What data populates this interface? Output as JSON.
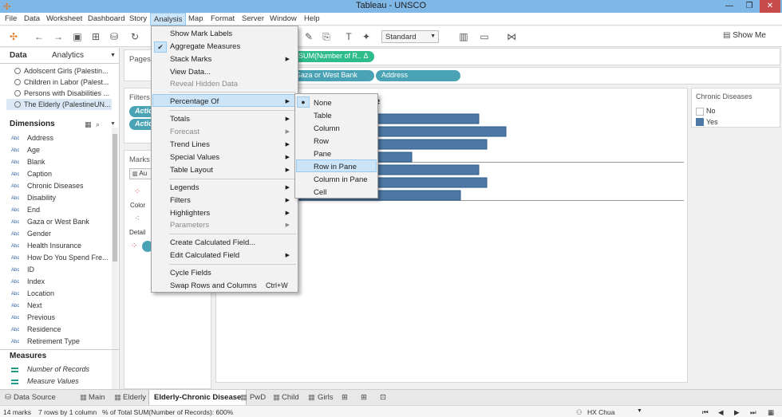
{
  "window": {
    "title": "Tableau - UNSCO"
  },
  "menubar": [
    "File",
    "Data",
    "Worksheet",
    "Dashboard",
    "Story",
    "Analysis",
    "Map",
    "Format",
    "Server",
    "Window",
    "Help"
  ],
  "toolbar": {
    "fit_value": "Standard",
    "show_me": "Show Me"
  },
  "left_pane": {
    "tabs": [
      "Data",
      "Analytics"
    ],
    "datasources": [
      "Adolscent Girls (Palestin...",
      "Children in Labor (Palest...",
      "Persons with Disabilities ...",
      "The Elderly (PalestineUN..."
    ],
    "dimensions_title": "Dimensions",
    "dimensions": [
      "Address",
      "Age",
      "Blank",
      "Caption",
      "Chronic Diseases",
      "Disability",
      "End",
      "Gaza or West Bank",
      "Gender",
      "Health Insurance",
      "How Do You Spend Fre...",
      "ID",
      "Index",
      "Location",
      "Next",
      "Previous",
      "Residence",
      "Retirement Type"
    ],
    "field_type_label": "Abc",
    "measures_title": "Measures",
    "measures": [
      "Number of Records",
      "Measure Values"
    ]
  },
  "shelves": {
    "pages": "Pages",
    "filters": "Filters",
    "filter_pills": [
      "Action",
      "Action"
    ],
    "marks": "Marks",
    "marks_type_short": "Au",
    "color": "Color",
    "detail": "Detail",
    "columns_pill": "SUM(Number of R..  Δ",
    "rows_pills": [
      "Gaza or West Bank",
      "Address"
    ]
  },
  "view": {
    "title_partial": "e"
  },
  "chart_data": {
    "type": "bar",
    "orientation": "horizontal",
    "values": [
      0.67,
      0.77,
      0.7,
      0.42,
      0.67,
      0.7,
      0.6
    ],
    "note_units": "fraction of pane"
  },
  "legend": {
    "title": "Chronic Diseases",
    "items": [
      {
        "label": "No",
        "color": "#ffffff"
      },
      {
        "label": "Yes",
        "color": "#4e79a7"
      }
    ]
  },
  "analysis_menu": [
    {
      "label": "Show Mark Labels"
    },
    {
      "label": "Aggregate Measures",
      "checked": true
    },
    {
      "label": "Stack Marks",
      "submenu": true
    },
    {
      "label": "View Data..."
    },
    {
      "label": "Reveal Hidden Data",
      "disabled": true
    },
    {
      "label": "Percentage Of",
      "submenu": true,
      "active": true
    },
    {
      "label": "Totals",
      "submenu": true
    },
    {
      "label": "Forecast",
      "submenu": true,
      "disabled": true
    },
    {
      "label": "Trend Lines",
      "submenu": true
    },
    {
      "label": "Special Values",
      "submenu": true
    },
    {
      "label": "Table Layout",
      "submenu": true
    },
    {
      "label": "Legends",
      "submenu": true
    },
    {
      "label": "Filters",
      "submenu": true
    },
    {
      "label": "Highlighters",
      "submenu": true
    },
    {
      "label": "Parameters",
      "submenu": true,
      "disabled": true
    },
    {
      "label": "Create Calculated Field..."
    },
    {
      "label": "Edit Calculated Field",
      "submenu": true
    },
    {
      "label": "Cycle Fields"
    },
    {
      "label": "Swap Rows and Columns",
      "shortcut": "Ctrl+W"
    }
  ],
  "percentage_submenu": [
    {
      "label": "None",
      "selected": true
    },
    {
      "label": "Table"
    },
    {
      "label": "Column"
    },
    {
      "label": "Row"
    },
    {
      "label": "Pane"
    },
    {
      "label": "Row in Pane",
      "hover": true
    },
    {
      "label": "Column in Pane"
    },
    {
      "label": "Cell"
    }
  ],
  "sheet_tabs": [
    "Data Source",
    "Main",
    "Elderly",
    "Elderly-Chronic Disease",
    "PwD",
    "Child",
    "Girls"
  ],
  "status": {
    "marks": "14 marks",
    "rows": "7 rows by 1 column",
    "sum": "% of Total SUM(Number of Records): 600%",
    "user": "HX Chua"
  }
}
